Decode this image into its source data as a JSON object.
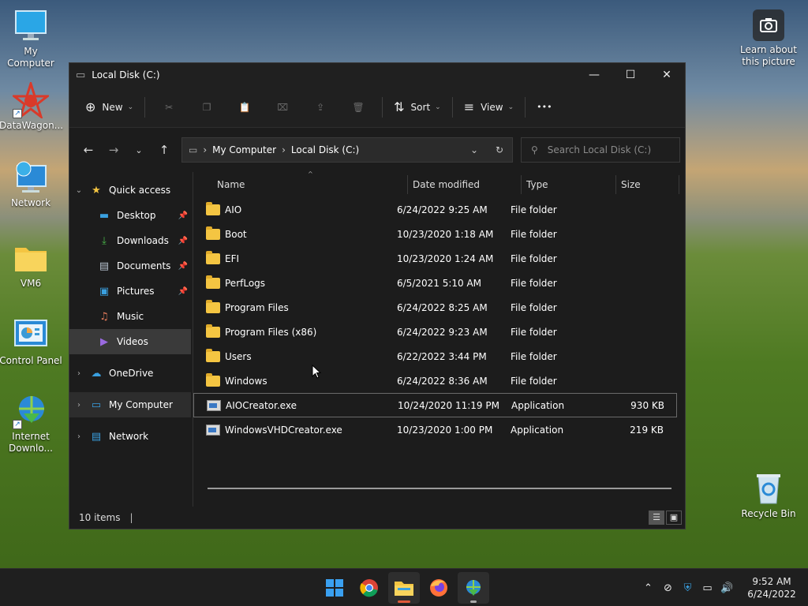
{
  "desktop": {
    "icons": {
      "my_computer": "My Computer",
      "datawagon": "DataWagon...",
      "network": "Network",
      "vm6": "VM6",
      "control_panel": "Control Panel",
      "internet_download": "Internet Downlo...",
      "learn_picture": "Learn about this picture",
      "recycle_bin": "Recycle Bin"
    }
  },
  "window": {
    "title": "Local Disk (C:)",
    "controls": {
      "minimize": "—",
      "maximize": "☐",
      "close": "✕"
    }
  },
  "toolbar": {
    "new_label": "New",
    "sort_label": "Sort",
    "view_label": "View",
    "more_label": "•••"
  },
  "address": {
    "crumbs": [
      "My Computer",
      "Local Disk (C:)"
    ],
    "search_placeholder": "Search Local Disk (C:)"
  },
  "sidebar": {
    "quick_access": "Quick access",
    "items": [
      {
        "label": "Desktop"
      },
      {
        "label": "Downloads"
      },
      {
        "label": "Documents"
      },
      {
        "label": "Pictures"
      },
      {
        "label": "Music"
      },
      {
        "label": "Videos"
      }
    ],
    "onedrive": "OneDrive",
    "my_computer": "My Computer",
    "network": "Network"
  },
  "columns": {
    "name": "Name",
    "date": "Date modified",
    "type": "Type",
    "size": "Size"
  },
  "files": [
    {
      "name": "AIO",
      "date": "6/24/2022 9:25 AM",
      "type": "File folder",
      "size": ""
    },
    {
      "name": "Boot",
      "date": "10/23/2020 1:18 AM",
      "type": "File folder",
      "size": ""
    },
    {
      "name": "EFI",
      "date": "10/23/2020 1:24 AM",
      "type": "File folder",
      "size": ""
    },
    {
      "name": "PerfLogs",
      "date": "6/5/2021 5:10 AM",
      "type": "File folder",
      "size": ""
    },
    {
      "name": "Program Files",
      "date": "6/24/2022 8:25 AM",
      "type": "File folder",
      "size": ""
    },
    {
      "name": "Program Files (x86)",
      "date": "6/24/2022 9:23 AM",
      "type": "File folder",
      "size": ""
    },
    {
      "name": "Users",
      "date": "6/22/2022 3:44 PM",
      "type": "File folder",
      "size": ""
    },
    {
      "name": "Windows",
      "date": "6/24/2022 8:36 AM",
      "type": "File folder",
      "size": ""
    },
    {
      "name": "AIOCreator.exe",
      "date": "10/24/2020 11:19 PM",
      "type": "Application",
      "size": "930 KB"
    },
    {
      "name": "WindowsVHDCreator.exe",
      "date": "10/23/2020 1:00 PM",
      "type": "Application",
      "size": "219 KB"
    }
  ],
  "status": {
    "count": "10 items",
    "bar": "|"
  },
  "taskbar": {
    "apps": [
      "windows-start",
      "chrome",
      "file-explorer",
      "firefox",
      "internet-download-manager"
    ],
    "time": "9:52 AM",
    "date": "6/24/2022"
  },
  "colors": {
    "folder": "#f4c542",
    "window_bg": "#1c1c1c",
    "selection": "#3a3a3a",
    "accent": "#0078d4"
  }
}
